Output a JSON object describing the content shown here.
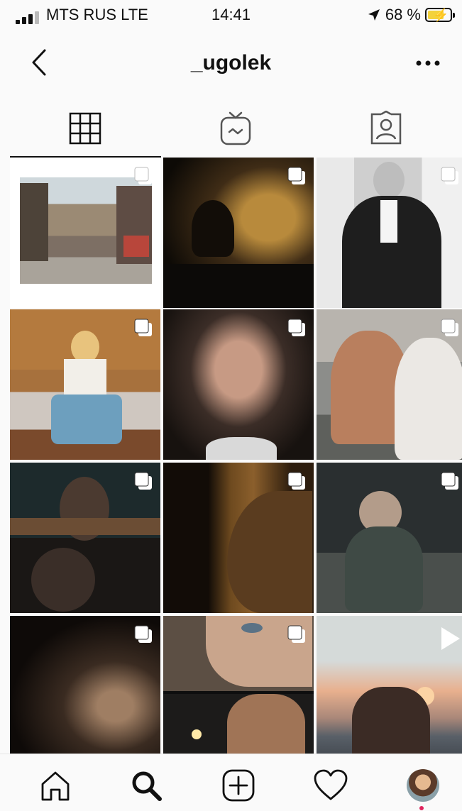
{
  "status_bar": {
    "carrier": "MTS RUS LTE",
    "time": "14:41",
    "battery": "68 %"
  },
  "header": {
    "username": "_ugolek",
    "back_icon": "chevron-left-icon",
    "more_icon": "more-horizontal-icon"
  },
  "tabs": [
    {
      "name": "grid",
      "icon": "grid-icon",
      "active": true
    },
    {
      "name": "igtv",
      "icon": "igtv-icon",
      "active": false
    },
    {
      "name": "tagged",
      "icon": "tagged-person-icon",
      "active": false
    }
  ],
  "posts": [
    {
      "type": "multiple",
      "scene": "street"
    },
    {
      "type": "multiple",
      "scene": "car-night"
    },
    {
      "type": "multiple",
      "scene": "suit-portrait"
    },
    {
      "type": "multiple",
      "scene": "bedroom"
    },
    {
      "type": "multiple",
      "scene": "face-tongue"
    },
    {
      "type": "multiple",
      "scene": "couple-sea"
    },
    {
      "type": "multiple",
      "scene": "coffee-table"
    },
    {
      "type": "multiple",
      "scene": "silhouette-profile"
    },
    {
      "type": "multiple",
      "scene": "swing"
    },
    {
      "type": "multiple",
      "scene": "dark-shoulder"
    },
    {
      "type": "multiple",
      "scene": "close-eyes"
    },
    {
      "type": "video",
      "scene": "sunset-sea"
    }
  ],
  "bottom_nav": [
    {
      "name": "home",
      "icon": "home-icon"
    },
    {
      "name": "search",
      "icon": "search-icon"
    },
    {
      "name": "create",
      "icon": "add-post-icon"
    },
    {
      "name": "activity",
      "icon": "heart-icon"
    },
    {
      "name": "profile",
      "icon": "avatar"
    }
  ],
  "colors": {
    "background": "#fafafa",
    "battery_fill": "#f3d23a",
    "notification": "#e0245e"
  }
}
